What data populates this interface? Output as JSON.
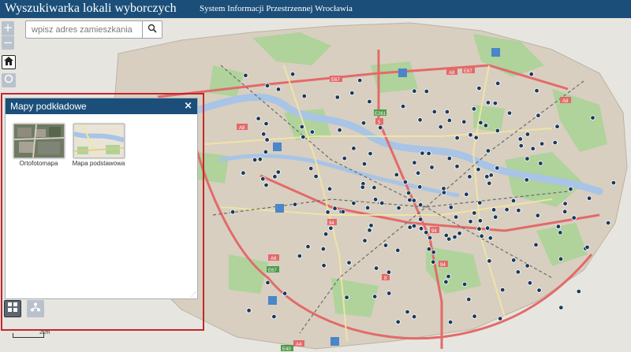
{
  "header": {
    "title": "Wyszukiwarka lokali wyborczych",
    "subtitle": "System Informacji Przestrzennej Wrocławia"
  },
  "search": {
    "placeholder": "wpisz adres zamieszkania",
    "icon": "search-icon"
  },
  "map_controls": {
    "zoom_in": "+",
    "zoom_out": "−",
    "home_icon": "home-icon",
    "locate_icon": "locate-icon"
  },
  "map": {
    "road_labels": [
      "E67",
      "A8",
      "E67",
      "A8",
      "E261",
      "5",
      "A8",
      "E67",
      "A4",
      "E40",
      "94",
      "94",
      "94",
      "A8",
      "8"
    ],
    "colors": {
      "urban": "#d8cfc0",
      "green": "#aed39a",
      "water": "#a8c4e6",
      "motorway": "#e36a6a",
      "polling_marker": "#1b3a5c"
    }
  },
  "basemap_panel": {
    "title": "Mapy podkładowe",
    "close": "×",
    "items": [
      {
        "label": "Ortofotomapa"
      },
      {
        "label": "Mapa podstawowa"
      }
    ]
  },
  "bottom_tools": {
    "basemap_icon": "grid-icon",
    "tree_icon": "layer-tree-icon"
  },
  "scale": {
    "label": "2km"
  }
}
